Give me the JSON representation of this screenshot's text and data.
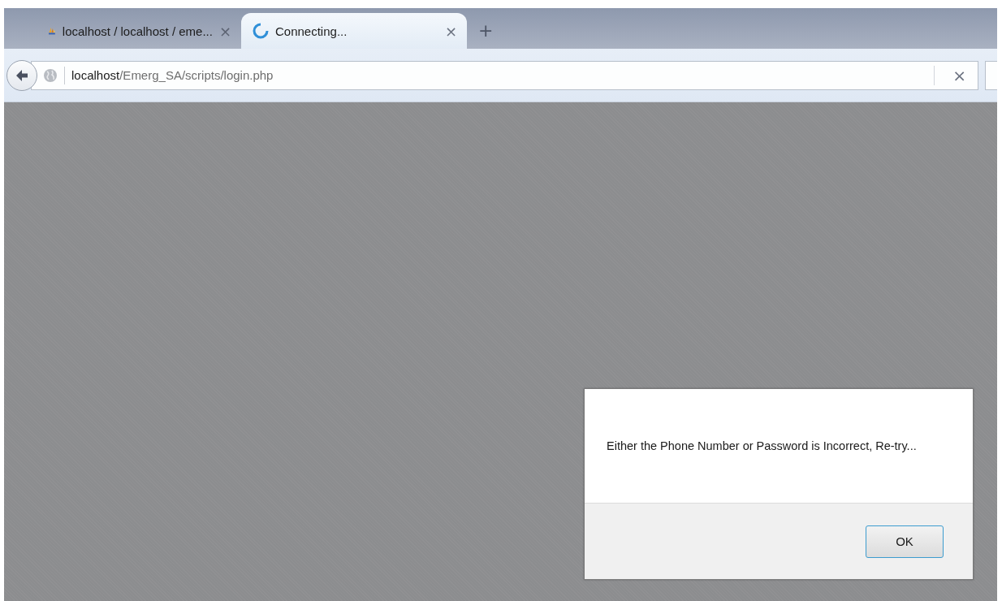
{
  "tabs": [
    {
      "kind": "page",
      "title": "localhost / localhost / eme...",
      "close": "×",
      "selected": false
    },
    {
      "kind": "loading",
      "title": "Connecting...",
      "close": "×",
      "selected": true
    }
  ],
  "new_tab": "+",
  "address_bar": {
    "host": "localhost",
    "path": "/Emerg_SA/scripts/login.php",
    "clear": "×"
  },
  "dialog": {
    "message": "Either the Phone Number or Password is Incorrect, Re-try...",
    "buttons": [
      "OK"
    ]
  }
}
